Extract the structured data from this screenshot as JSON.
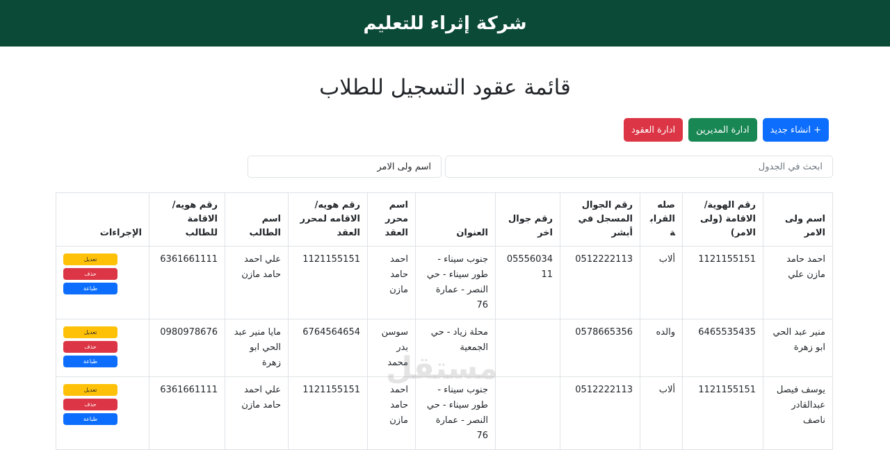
{
  "header": {
    "brand": "شركة إثراء للتعليم"
  },
  "page": {
    "title": "قائمة عقود التسجيل للطلاب"
  },
  "toolbar": {
    "create_label": "+ انشاء جديد",
    "managers_label": "ادارة المديرين",
    "contracts_label": "ادارة العقود"
  },
  "filters": {
    "search_placeholder": "ابحث في الجدول",
    "guardian_placeholder": "اسم ولى الامر"
  },
  "table": {
    "headers": [
      "اسم ولى الامر",
      "رقم الهوية/ الاقامة (ولى الامر)",
      "صله القرابة",
      "رقم الجوال المسجل في أبشر",
      "رقم جوال اخر",
      "العنوان",
      "اسم محرر العقد",
      "رقم هويه/ الاقامه لمحرر العقد",
      "اسم الطالب",
      "رقم هويه/ الاقامة للطالب",
      "الإجراءات"
    ],
    "rows": [
      {
        "guardian": "احمد حامد مازن علي",
        "guardian_id": "1121155151",
        "relation": "ألاب",
        "absher_phone": "0512222113",
        "other_phone": "0555603411",
        "address": "جنوب سيناء - طور سيناء - حي النصر - عمارة 76",
        "editor_name": "احمد حامد مازن",
        "editor_id": "1121155151",
        "student_name": "علي احمد حامد مازن",
        "student_id": "6361661111"
      },
      {
        "guardian": "منير عبد الحي ابو زهرة",
        "guardian_id": "6465535435",
        "relation": "والده",
        "absher_phone": "0578665356",
        "other_phone": "",
        "address": "محلة زياد - حي الجمعية",
        "editor_name": "سوسن بدر محمد",
        "editor_id": "6764564654",
        "student_name": "مايا منير عبد الحي ابو زهرة",
        "student_id": "0980978676"
      },
      {
        "guardian": "يوسف فيصل عبدالقادر ناصف",
        "guardian_id": "1121155151",
        "relation": "ألاب",
        "absher_phone": "0512222113",
        "other_phone": "",
        "address": "جنوب سيناء - طور سيناء - حي النصر - عمارة 76",
        "editor_name": "احمد حامد مازن",
        "editor_id": "1121155151",
        "student_name": "علي احمد حامد مازن",
        "student_id": "6361661111"
      }
    ],
    "row_actions": {
      "edit": "تعديل",
      "delete": "حذف",
      "print": "طباعة"
    }
  },
  "watermark": "مستقل",
  "colors": {
    "header_bg": "#0b4a36",
    "primary": "#0d6efd",
    "success": "#198754",
    "danger": "#dc3545",
    "warning": "#ffc107"
  }
}
